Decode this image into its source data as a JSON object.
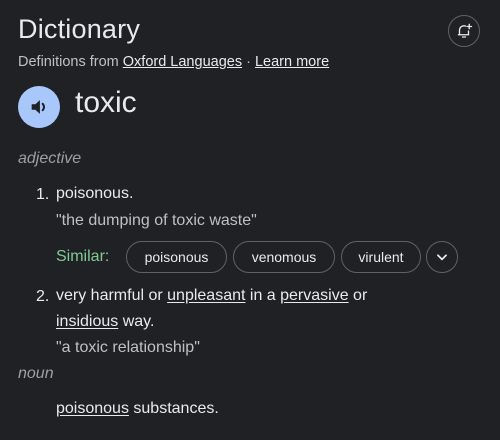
{
  "header": {
    "title": "Dictionary",
    "source_prefix": "Definitions from",
    "source_link": "Oxford Languages",
    "separator": "·",
    "learn_more": "Learn more",
    "alert_icon": "bell-plus-icon"
  },
  "entry": {
    "word": "toxic",
    "speaker_icon": "speaker-icon",
    "pos_adjective": "adjective",
    "def1_num": "1.",
    "def1_text": "poisonous.",
    "def1_example": "\"the dumping of toxic waste\"",
    "similar_label": "Similar:",
    "similar": [
      "poisonous",
      "venomous",
      "virulent"
    ],
    "def2_num": "2.",
    "def2_parts": [
      "very harmful or ",
      "unpleasant",
      " in a ",
      "pervasive",
      " or",
      "insidious",
      " way."
    ],
    "def2_example": "\"a toxic relationship\"",
    "pos_noun": "noun",
    "noun_parts": [
      "poisonous",
      " substances."
    ]
  },
  "colors": {
    "background": "#202124",
    "similar_label": "#81c995",
    "speaker_button": "#a8c7fa"
  }
}
